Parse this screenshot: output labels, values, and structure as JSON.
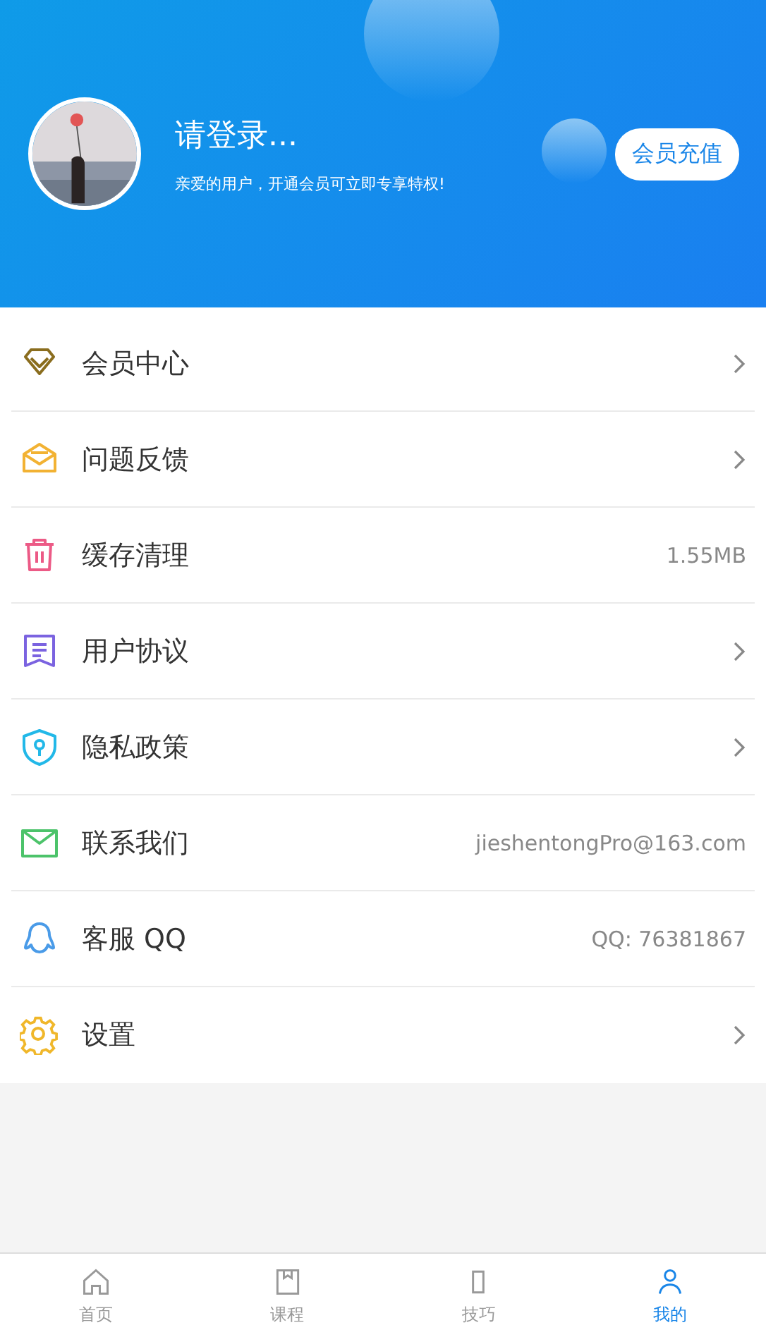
{
  "profile": {
    "title": "请登录...",
    "subtitle": "亲爱的用户，开通会员可立即专享特权!",
    "button": "会员充值"
  },
  "menu": [
    {
      "label": "会员中心",
      "kind": "chevron",
      "color": "#8a6d1e"
    },
    {
      "label": "问题反馈",
      "kind": "chevron",
      "color": "#f2b233"
    },
    {
      "label": "缓存清理",
      "kind": "value",
      "value": "1.55MB",
      "color": "#ec5a86"
    },
    {
      "label": "用户协议",
      "kind": "chevron",
      "color": "#7b63e0"
    },
    {
      "label": "隐私政策",
      "kind": "chevron",
      "color": "#22b8e8"
    },
    {
      "label": "联系我们",
      "kind": "value",
      "value": "jieshentongPro@163.com",
      "color": "#4cc36a"
    },
    {
      "label": "客服 QQ",
      "kind": "value",
      "value": "QQ: 76381867",
      "color": "#4a9be8"
    },
    {
      "label": "设置",
      "kind": "chevron",
      "color": "#f0b72a"
    }
  ],
  "tabs": [
    {
      "label": "首页",
      "selected": false
    },
    {
      "label": "课程",
      "selected": false
    },
    {
      "label": "技巧",
      "selected": false
    },
    {
      "label": "我的",
      "selected": true
    }
  ]
}
